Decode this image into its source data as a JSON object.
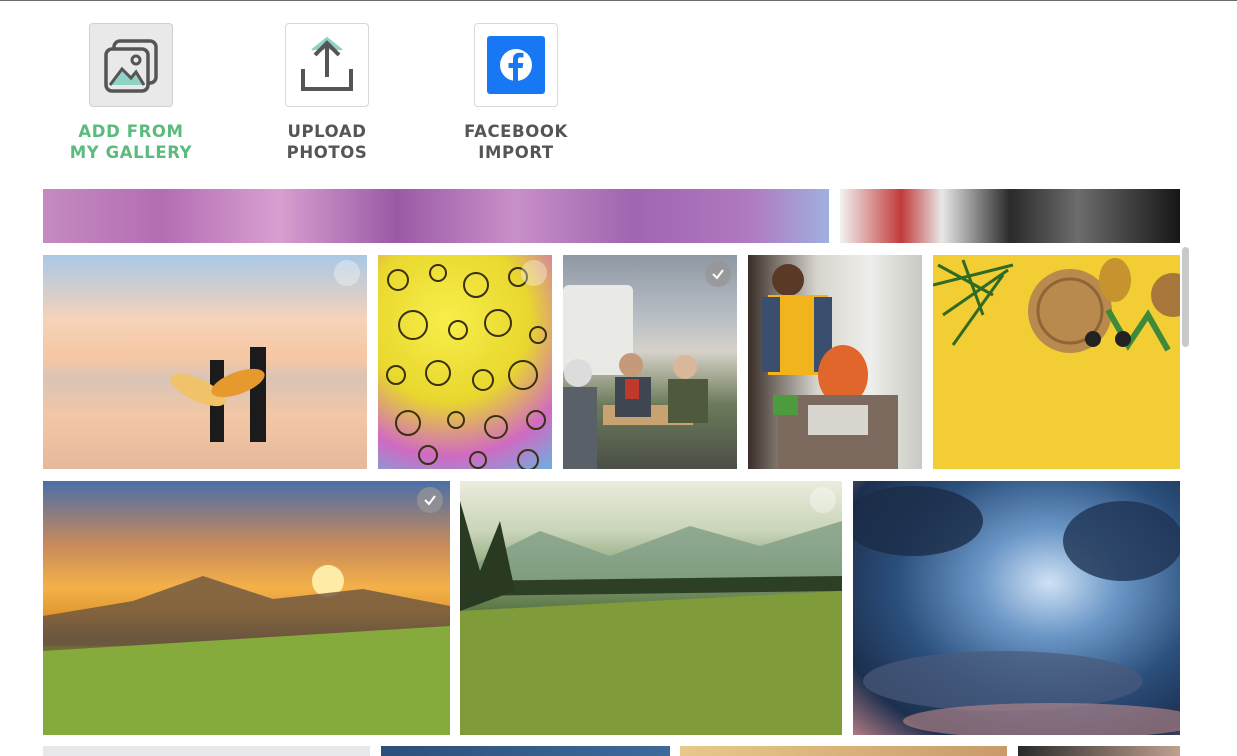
{
  "sources": [
    {
      "line1": "ADD FROM",
      "line2": "MY GALLERY",
      "icon": "gallery-image-icon",
      "active": true
    },
    {
      "line1": "UPLOAD",
      "line2": "PHOTOS",
      "icon": "upload-arrow-icon",
      "active": false
    },
    {
      "line1": "FACEBOOK",
      "line2": "IMPORT",
      "icon": "facebook-icon",
      "active": false
    }
  ],
  "colors": {
    "accent_green": "#5cba7d",
    "facebook_blue": "#1877f2",
    "label_gray": "#555555",
    "tile_active_bg": "#e9e9e9"
  },
  "gallery": {
    "row_partial_top": [
      "pink clouds sky",
      "dog close-up"
    ],
    "row_1": [
      "surfers on beach at sunset",
      "colorful oil bubbles",
      "seniors dining by camper van",
      "man packing produce bag",
      "straw bag and pineapple on yellow"
    ],
    "row_2": [
      "mountain sunset over meadow",
      "green valley with forest",
      "dramatic stormy sky"
    ],
    "row_partial_bottom": [
      "snow texture",
      "dark blue sky",
      "warm blurred light",
      "portrait"
    ]
  }
}
